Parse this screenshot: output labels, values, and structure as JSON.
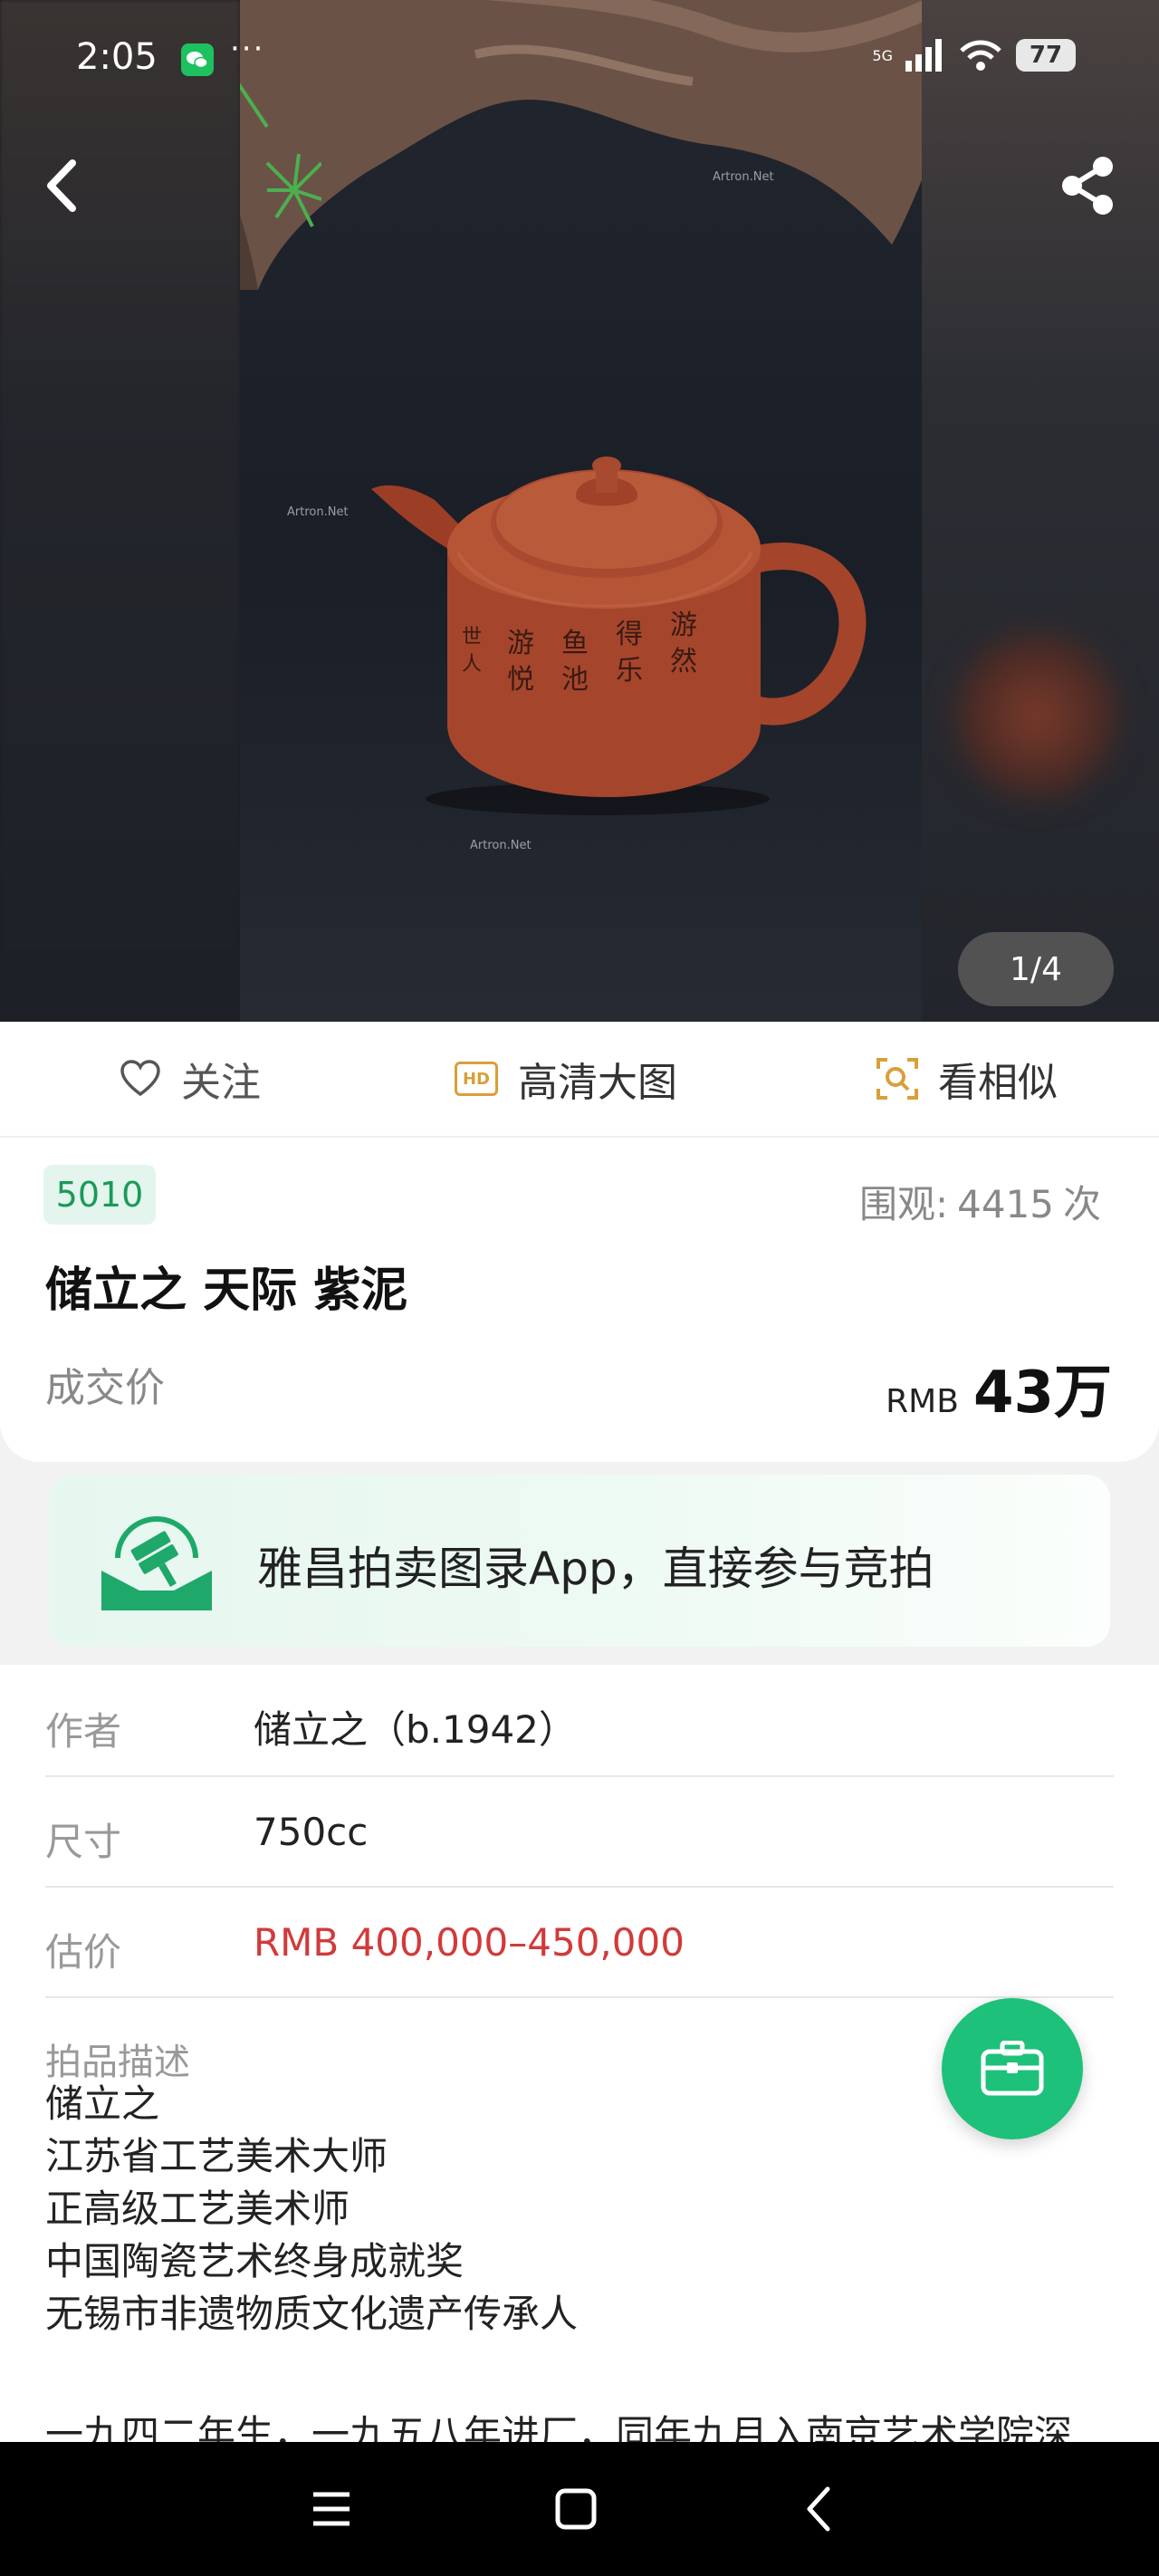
{
  "status_bar": {
    "time": "2:05",
    "dots": "···",
    "network": "5G",
    "battery": "77"
  },
  "gallery": {
    "counter": "1/4",
    "watermark": "Artron.Net"
  },
  "actions": {
    "follow": "关注",
    "hd_badge": "HD",
    "hd": "高清大图",
    "similar": "看相似"
  },
  "lot": {
    "number": "5010",
    "views_label": "围观:",
    "views_count": "4415",
    "views_unit": "次",
    "title": "储立之 天际  紫泥",
    "price_label": "成交价",
    "price_currency": "RMB",
    "price_value": "43万"
  },
  "promo": {
    "text": "雅昌拍卖图录App，直接参与竞拍"
  },
  "details": {
    "author_label": "作者",
    "author_value": "储立之（b.1942）",
    "size_label": "尺寸",
    "size_value": "750cc",
    "estimate_label": "估价",
    "estimate_value": "RMB  400,000–450,000",
    "description_label": "拍品描述",
    "description_lines": [
      "储立之",
      "江苏省工艺美术大师",
      "正高级工艺美术师",
      "中国陶瓷艺术终身成就奖",
      "无锡市非遗物质文化遗产传承人"
    ],
    "description_para": "一九四二年生，一九五八年进厂，同年九月入南京艺术学院深"
  },
  "colors": {
    "accent_green": "#1ec17a",
    "estimate_red": "#d23a3a",
    "hd_gold": "#d8a03a"
  }
}
